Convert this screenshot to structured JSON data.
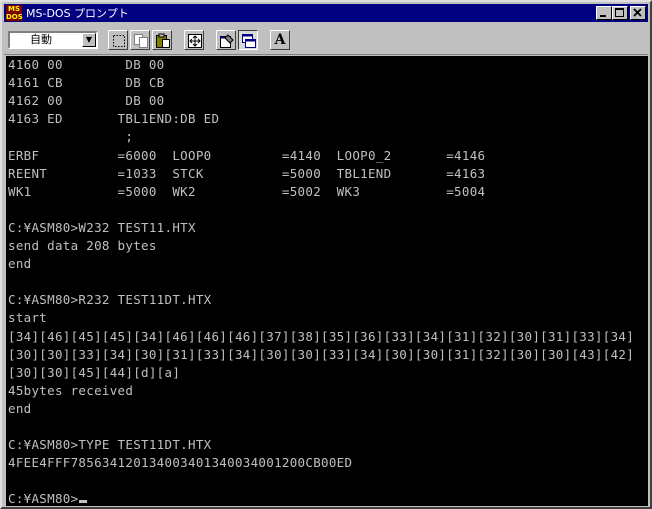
{
  "window": {
    "title": "MS-DOS プロンプト",
    "font_size_value": "自動"
  },
  "icons": {
    "app": "ms-dos-icon",
    "minimize": "minimize-icon",
    "maximize": "maximize-icon",
    "close": "close-icon",
    "mark": "mark-icon",
    "copy": "copy-icon",
    "paste": "paste-icon",
    "fullscreen": "fullscreen-icon",
    "properties": "properties-icon",
    "background": "background-icon",
    "font": "font-icon"
  },
  "buttons": {
    "font_label": "A"
  },
  "terminal": {
    "lines": [
      "4160 00        DB 00",
      "4161 CB        DB CB",
      "4162 00        DB 00",
      "4163 ED       TBL1END:DB ED",
      "               ;",
      "ERBF          =6000  LOOP0         =4140  LOOP0_2       =4146",
      "REENT         =1033  STCK          =5000  TBL1END       =4163",
      "WK1           =5000  WK2           =5002  WK3           =5004",
      "",
      "C:¥ASM80>W232 TEST11.HTX",
      "send data 208 bytes",
      "end",
      "",
      "C:¥ASM80>R232 TEST11DT.HTX",
      "start",
      "[34][46][45][45][34][46][46][46][37][38][35][36][33][34][31][32][30][31][33][34]",
      "[30][30][33][34][30][31][33][34][30][30][33][34][30][30][31][32][30][30][43][42]",
      "[30][30][45][44][d][a]",
      "45bytes received",
      "end",
      "",
      "C:¥ASM80>TYPE TEST11DT.HTX",
      "4FEE4FFF785634120134003401340034001200CB00ED",
      "",
      "C:¥ASM80>"
    ]
  }
}
